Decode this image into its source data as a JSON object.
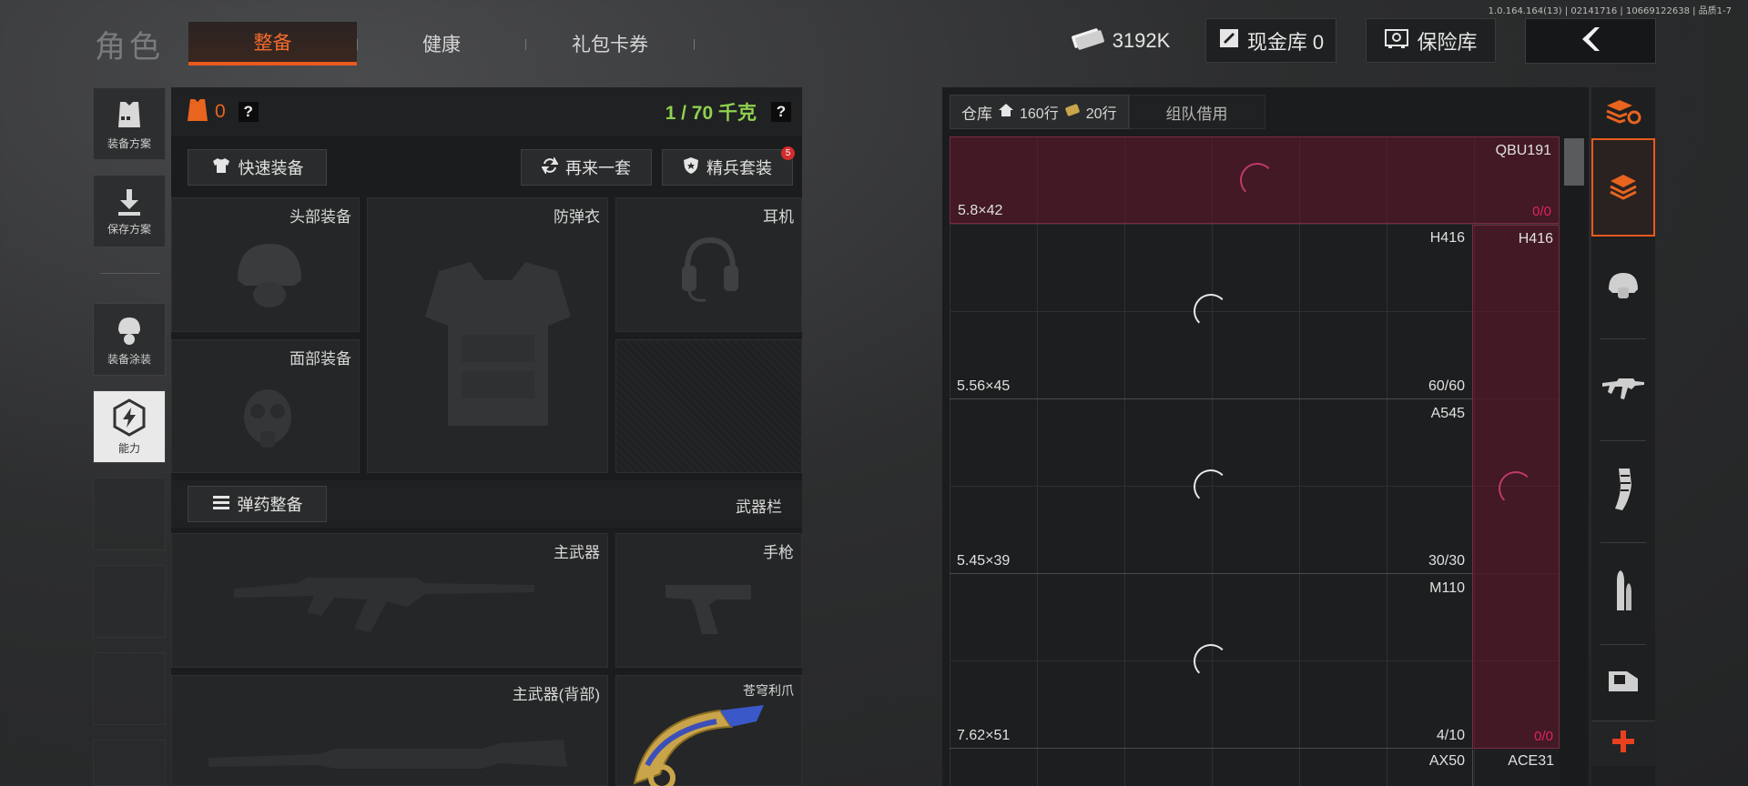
{
  "version": "1.0.164.164(13) | 02141716 | 10669122638 | 品质1-7",
  "header": {
    "title": "角色",
    "tabs": [
      {
        "label": "整备",
        "active": true
      },
      {
        "label": "健康",
        "active": false
      },
      {
        "label": "礼包卡券",
        "active": false
      }
    ],
    "currency": "3192K",
    "cash_vault": "现金库 0",
    "safe": "保险库"
  },
  "sidebar": {
    "items": [
      {
        "label": "装备方案",
        "icon": "vest-plan-icon"
      },
      {
        "label": "保存方案",
        "icon": "download-icon"
      },
      {
        "label": "装备涂装",
        "icon": "helmet-skin-icon"
      },
      {
        "label": "能力",
        "icon": "ability-hex-icon",
        "active": true
      }
    ]
  },
  "loadout": {
    "armor_count": "0",
    "weight": "1 / 70 千克",
    "quick_equip": "快速装备",
    "reroll": "再来一套",
    "elite_set": "精兵套装",
    "elite_badge": "5",
    "ammo_equip": "弹药整备",
    "weapon_bar": "武器栏",
    "slots": {
      "head": "头部装备",
      "body": "防弹衣",
      "ear": "耳机",
      "face": "面部装备",
      "primary": "主武器",
      "pistol": "手枪",
      "primary_back": "主武器(背部)",
      "melee": "苍穹利爪"
    }
  },
  "warehouse": {
    "tab_label": "仓库",
    "rows_home": "160行",
    "rows_ticket": "20行",
    "team_borrow": "组队借用",
    "items": [
      {
        "caliber": "5.8×42",
        "weapon": "QBU191",
        "count": "0/0"
      },
      {
        "caliber": "5.56×45",
        "weapon": "H416",
        "count": "60/60",
        "side_weapon": "H416"
      },
      {
        "caliber": "5.45×39",
        "weapon": "A545",
        "count": "30/30"
      },
      {
        "caliber": "7.62×51",
        "weapon": "M110",
        "count": "4/10",
        "side_count": "0/0"
      },
      {
        "caliber": "",
        "weapon": "AX50",
        "count": "",
        "side_weapon": "ACE31"
      }
    ]
  },
  "categories": [
    "stack-refresh-icon",
    "layers-icon",
    "helmet-icon",
    "rifle-icon",
    "magazine-icon",
    "bullet-icon",
    "scope-icon",
    "plus-icon"
  ],
  "colors": {
    "accent": "#e85a1e",
    "weight_green": "#8fd14f",
    "highlight": "#5e1a2e",
    "count_red": "#e0245e"
  }
}
